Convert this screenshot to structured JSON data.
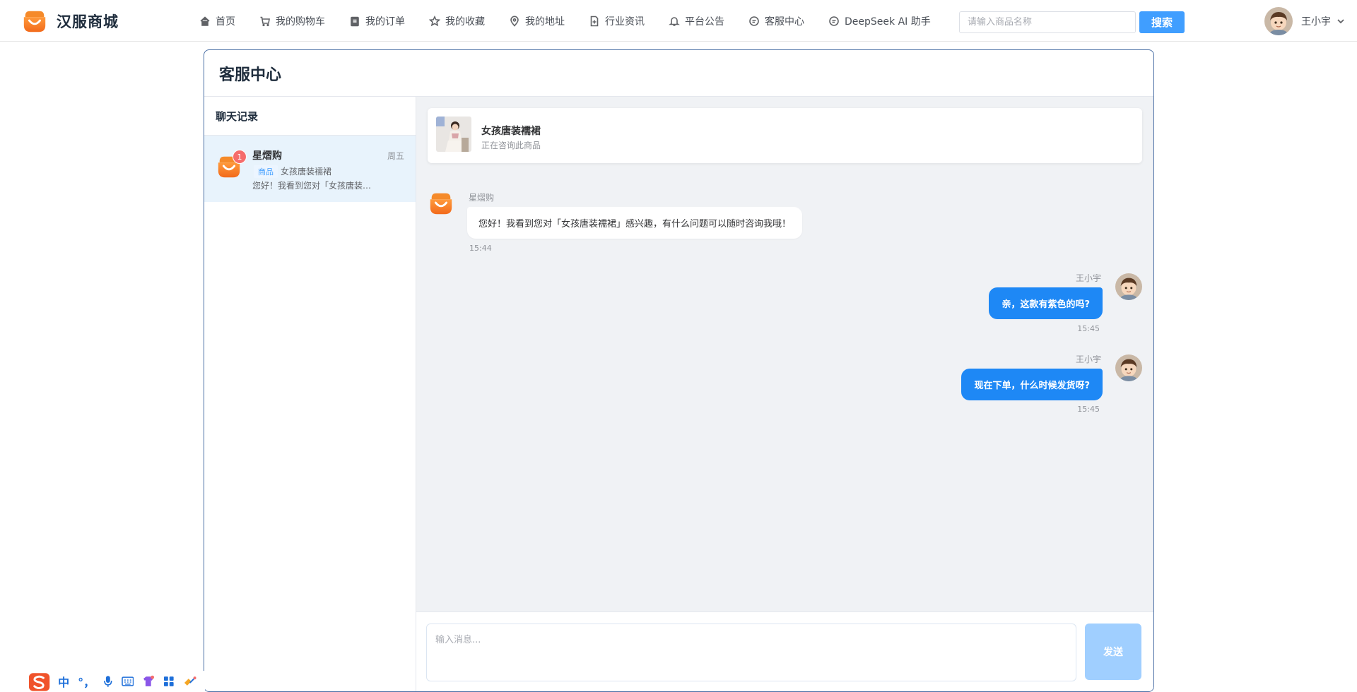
{
  "header": {
    "brand": "汉服商城",
    "nav": [
      {
        "label": "首页",
        "icon": "home-icon"
      },
      {
        "label": "我的购物车",
        "icon": "cart-icon"
      },
      {
        "label": "我的订单",
        "icon": "clipboard-icon"
      },
      {
        "label": "我的收藏",
        "icon": "star-icon"
      },
      {
        "label": "我的地址",
        "icon": "location-icon"
      },
      {
        "label": "行业资讯",
        "icon": "document-add-icon"
      },
      {
        "label": "平台公告",
        "icon": "bell-icon"
      },
      {
        "label": "客服中心",
        "icon": "chat-icon"
      },
      {
        "label": "DeepSeek AI 助手",
        "icon": "chat-icon"
      }
    ],
    "search_placeholder": "请输入商品名称",
    "search_button": "搜索",
    "user_name": "王小宇"
  },
  "page": {
    "title": "客服中心",
    "sidebar_title": "聊天记录",
    "conversation": {
      "name": "星熠购",
      "time": "周五",
      "badge": "1",
      "tag": "商品",
      "product": "女孩唐装襦裙",
      "preview": "您好！我看到您对「女孩唐装襦裙」感兴趣，有什么问题可以随时咨询我哦！"
    },
    "product_card": {
      "name": "女孩唐装襦裙",
      "subtitle": "正在咨询此商品"
    },
    "messages": [
      {
        "sender": "星熠购",
        "text": "您好！我看到您对「女孩唐装襦裙」感兴趣，有什么问题可以随时咨询我哦！",
        "time": "15:44",
        "direction": "in"
      },
      {
        "sender": "王小宇",
        "text": "亲，这款有紫色的吗?",
        "time": "15:45",
        "direction": "out"
      },
      {
        "sender": "王小宇",
        "text": "现在下单，什么时候发货呀?",
        "time": "15:45",
        "direction": "out"
      }
    ],
    "input_placeholder": "输入消息...",
    "send_button": "发送"
  },
  "ime": {
    "lang": "中",
    "punct": "°，"
  },
  "colors": {
    "primary": "#409eff",
    "out_bubble": "#1e88f5",
    "send_disabled": "#a0cfff",
    "badge": "#f56c6c",
    "selected_conv": "#e8f3fc"
  }
}
